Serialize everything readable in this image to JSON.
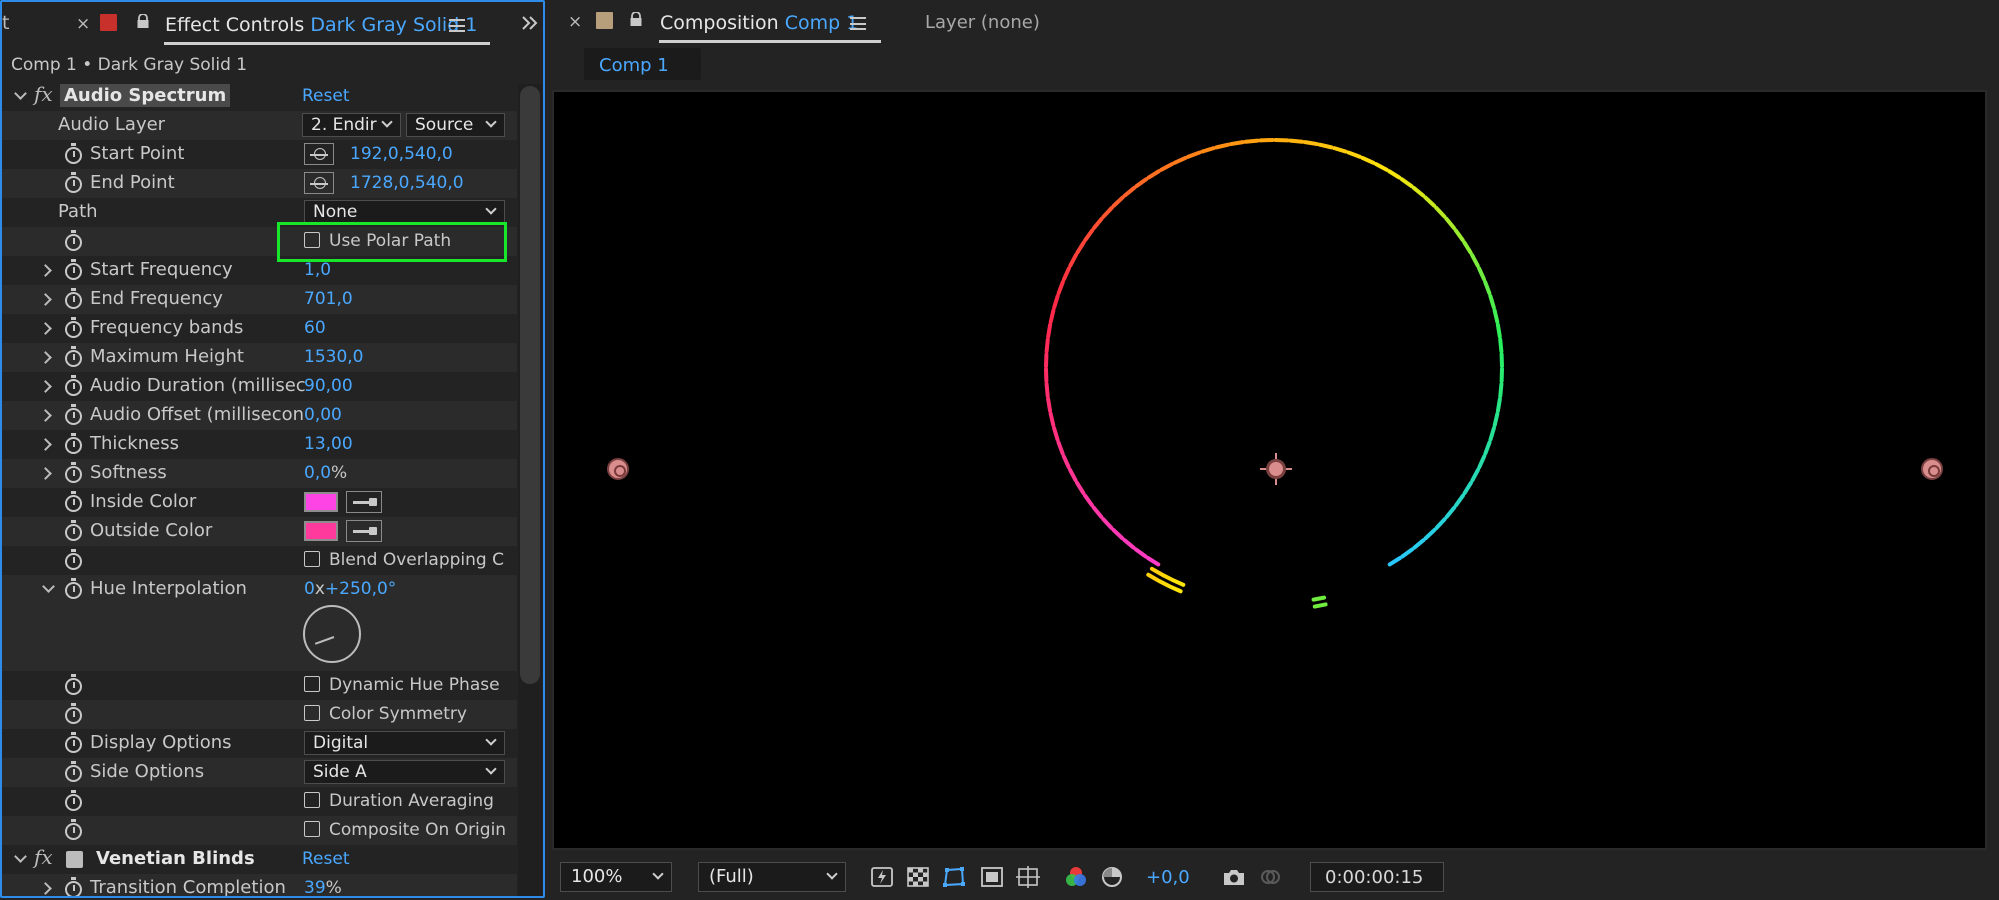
{
  "left_tabbar": {
    "partial_tab_label": "t",
    "title": "Effect Controls",
    "layer_name": "Dark Gray Solid 1",
    "swatch_color": "#c8302c"
  },
  "breadcrumb": "Comp 1 • Dark Gray Solid 1",
  "audio_spectrum": {
    "name": "Audio Spectrum",
    "reset": "Reset",
    "audio_layer": {
      "label": "Audio Layer",
      "layer": "2. Endir",
      "source": "Source"
    },
    "start_point": {
      "label": "Start Point",
      "value": "192,0,540,0"
    },
    "end_point": {
      "label": "End Point",
      "value": "1728,0,540,0"
    },
    "path": {
      "label": "Path",
      "value": "None"
    },
    "use_polar_path": {
      "label": "Use Polar Path",
      "checked": false
    },
    "start_frequency": {
      "label": "Start Frequency",
      "value": "1,0"
    },
    "end_frequency": {
      "label": "End Frequency",
      "value": "701,0"
    },
    "frequency_bands": {
      "label": "Frequency bands",
      "value": "60"
    },
    "maximum_height": {
      "label": "Maximum Height",
      "value": "1530,0"
    },
    "audio_duration": {
      "label": "Audio Duration (millisec",
      "value": "90,00"
    },
    "audio_offset": {
      "label": "Audio Offset (millisecon",
      "value": "0,00"
    },
    "thickness": {
      "label": "Thickness",
      "value": "13,00"
    },
    "softness": {
      "label": "Softness",
      "value": "0,0",
      "unit": "%"
    },
    "inside_color": {
      "label": "Inside Color",
      "color": "#ff44e6"
    },
    "outside_color": {
      "label": "Outside Color",
      "color": "#ff3a9c"
    },
    "blend_overlapping": {
      "label": "Blend Overlapping C",
      "checked": false
    },
    "hue_interpolation": {
      "label": "Hue Interpolation",
      "revolutions": "0",
      "x": "x",
      "value": "+250,0°"
    },
    "dynamic_hue_phase": {
      "label": "Dynamic Hue Phase",
      "checked": false
    },
    "color_symmetry": {
      "label": "Color Symmetry",
      "checked": false
    },
    "display_options": {
      "label": "Display Options",
      "value": "Digital"
    },
    "side_options": {
      "label": "Side Options",
      "value": "Side A"
    },
    "duration_averaging": {
      "label": "Duration Averaging",
      "checked": false
    },
    "composite_on_origin": {
      "label": "Composite On Origin",
      "checked": false
    }
  },
  "venetian_blinds": {
    "name": "Venetian Blinds",
    "reset": "Reset",
    "transition_completion": {
      "label": "Transition Completion",
      "value": "39",
      "unit": "%"
    }
  },
  "right_tabbar": {
    "title": "Composition",
    "comp_name": "Comp 1",
    "layer_tab": "Layer (none)",
    "swatch_color": "#b89f7c"
  },
  "view_tab": "Comp 1",
  "bottom_bar": {
    "zoom": "100%",
    "resolution": "(Full)",
    "exposure": "+0,0",
    "timecode": "0:00:00:15"
  },
  "colors": {
    "accent": "#4aa8ff",
    "highlight_box": "#19e62a",
    "panel_border": "#2d8ceb"
  }
}
